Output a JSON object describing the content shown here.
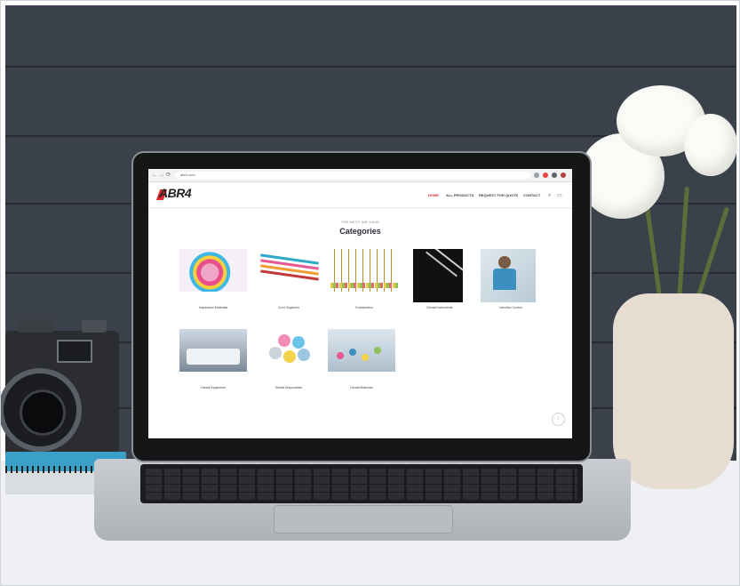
{
  "browser": {
    "url": "abr4.com",
    "nav_back": "←",
    "nav_forward": "→",
    "nav_reload": "⟳"
  },
  "site": {
    "logo": "ABR4",
    "menu": [
      {
        "label": "HOME",
        "active": true
      },
      {
        "label": "ALL PRODUCTS",
        "active": false
      },
      {
        "label": "REQUEST FOR QUOTE",
        "active": false
      },
      {
        "label": "CONTACT",
        "active": false
      }
    ],
    "icons": [
      "search-icon",
      "cart-icon"
    ]
  },
  "content": {
    "eyebrow": "THE BEST WE HAVE",
    "heading": "Categories",
    "categories": [
      {
        "label": "Impression Materials"
      },
      {
        "label": "Cord Organizer"
      },
      {
        "label": "Endodontics"
      },
      {
        "label": "Dental Instruments"
      },
      {
        "label": "Infection Control"
      },
      {
        "label": "Dental Equipment"
      },
      {
        "label": "Dental Disposables"
      },
      {
        "label": "Dental Materials"
      }
    ]
  },
  "colors": {
    "accent": "#d92c2c",
    "heading": "#2a2a3a",
    "wall": "#3a414b"
  }
}
